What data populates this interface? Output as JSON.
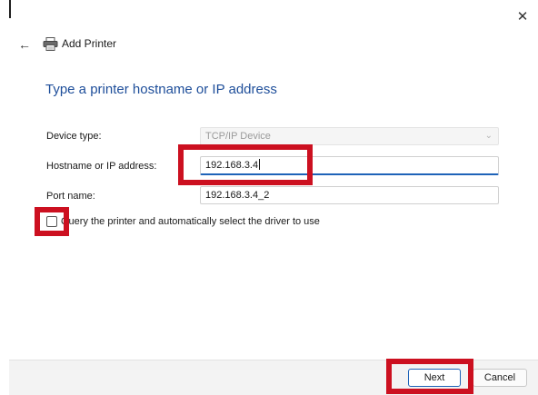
{
  "window": {
    "title": "Add Printer",
    "close_glyph": "✕",
    "back_glyph": "←",
    "printer_icon": "printer-icon"
  },
  "page": {
    "heading": "Type a printer hostname or IP address"
  },
  "form": {
    "device_type_label": "Device type:",
    "device_type_value": "TCP/IP Device",
    "hostname_label": "Hostname or IP address:",
    "hostname_value": "192.168.3.4",
    "port_label": "Port name:",
    "port_value": "192.168.3.4_2",
    "query_checkbox_label": "Query the printer and automatically select the driver to use",
    "query_checkbox_checked": false
  },
  "footer": {
    "next_label": "Next",
    "cancel_label": "Cancel"
  },
  "colors": {
    "heading": "#1e4e9a",
    "accent": "#1e63b8",
    "highlight_annotation": "#cc1020"
  }
}
